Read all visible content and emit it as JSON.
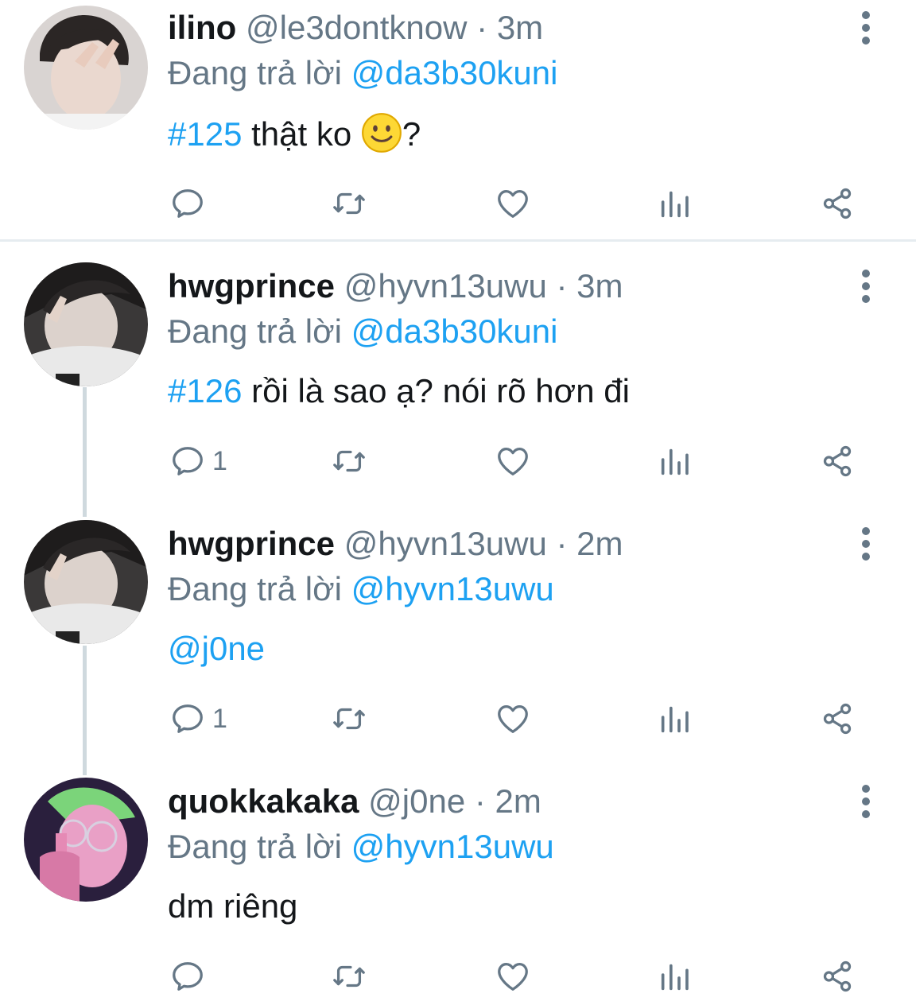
{
  "colors": {
    "accent": "#1da1f2",
    "muted": "#657786",
    "text": "#14171a",
    "divider": "#e6ecf0",
    "thread_line": "#cfd9de"
  },
  "replying_prefix": "Đang trả lời",
  "tweets": [
    {
      "name": "ilino",
      "handle": "@le3dontknow",
      "sep": "·",
      "time": "3m",
      "reply_to": "@da3b30kuni",
      "hashtag": "#125",
      "text": " thật ko ",
      "text_suffix": "?",
      "reply_count": "",
      "avatar_icon": "avatar-photo"
    },
    {
      "name": "hwgprince",
      "handle": "@hyvn13uwu",
      "sep": "·",
      "time": "3m",
      "reply_to": "@da3b30kuni",
      "hashtag": "#126",
      "text": " rồi là sao ạ? nói rõ hơn đi",
      "reply_count": "1",
      "avatar_icon": "avatar-photo"
    },
    {
      "name": "hwgprince",
      "handle": "@hyvn13uwu",
      "sep": "·",
      "time": "2m",
      "reply_to": "@hyvn13uwu",
      "mention": "@j0ne",
      "reply_count": "1",
      "avatar_icon": "avatar-photo"
    },
    {
      "name": "quokkakaka",
      "handle": "@j0ne",
      "sep": "·",
      "time": "2m",
      "reply_to": "@hyvn13uwu",
      "text": "dm riêng",
      "reply_count": "",
      "avatar_icon": "avatar-photo"
    }
  ],
  "action_icons": [
    "reply-icon",
    "retweet-icon",
    "like-icon",
    "analytics-icon",
    "share-icon"
  ]
}
